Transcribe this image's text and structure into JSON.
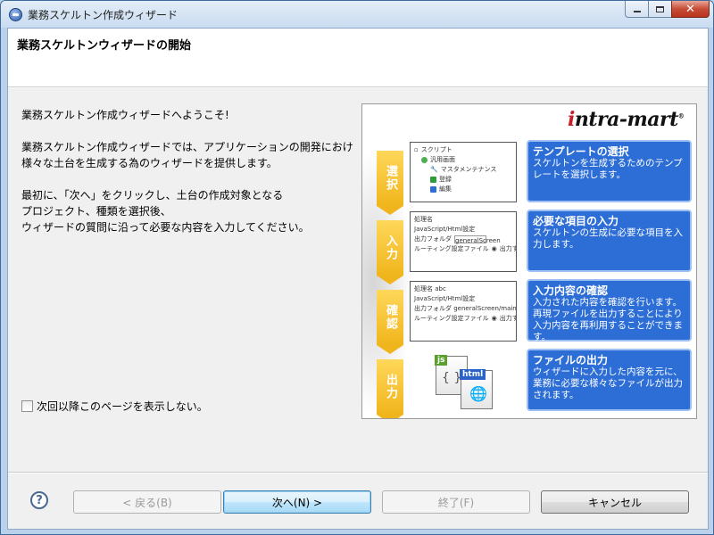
{
  "window": {
    "title": "業務スケルトン作成ウィザード"
  },
  "header": {
    "title": "業務スケルトンウィザードの開始"
  },
  "body": {
    "welcome": "業務スケルトン作成ウィザードへようこそ!",
    "description_lines": [
      "業務スケルトン作成ウィザードでは、アプリケーションの開発におけ",
      "様々な土台を生成する為のウィザードを提供します。"
    ],
    "instruction_lines": [
      "最初に、「次へ」をクリックし、土台の作成対象となる",
      "プロジェクト、種類を選択後、",
      "ウィザードの質問に沿って必要な内容を入力してください。"
    ],
    "checkbox_label": "次回以降このページを表示しない。"
  },
  "illustration": {
    "logo": "intra-mart",
    "logo_mark": "®",
    "stages": [
      {
        "label": "選択"
      },
      {
        "label": "入力"
      },
      {
        "label": "確認"
      },
      {
        "label": "出力"
      }
    ],
    "boxes": [
      {
        "title": "テンプレートの選択",
        "text": "スケルトンを生成するためのテンプレートを選択します。"
      },
      {
        "title": "必要な項目の入力",
        "text": "スケルトンの生成に必要な項目を入力します。"
      },
      {
        "title": "入力内容の確認",
        "text": "入力された内容を確認を行います。再現ファイルを出力することにより入力内容を再利用することができます。"
      },
      {
        "title": "ファイルの出力",
        "text": "ウィザードに入力した内容を元に、業務に必要な様々なファイルが出力されます。"
      }
    ],
    "shot1": [
      "スクリプト",
      "汎用画面",
      "マスタメンテナンス",
      "登録",
      "編集"
    ],
    "shot2": [
      "処理名",
      "JavaScript/Html設定",
      "出力フォルダ",
      "generalScreen",
      "ルーティング設定ファイル",
      "出力する"
    ],
    "shot3": [
      "処理名 abc",
      "JavaScript/Html設定",
      "出力フォルダ generalScreen/maintenance",
      "ルーティング設定ファイル",
      "出力する"
    ],
    "file_tags": [
      "js",
      "html"
    ]
  },
  "buttons": {
    "help": "?",
    "back": "< 戻る(B)",
    "next": "次へ(N) >",
    "finish": "終了(F)",
    "cancel": "キャンセル"
  },
  "colors": {
    "accent_box": "#2d6ed6",
    "stage_yellow": "#f0b51c",
    "logo_red": "#c81e2a"
  }
}
